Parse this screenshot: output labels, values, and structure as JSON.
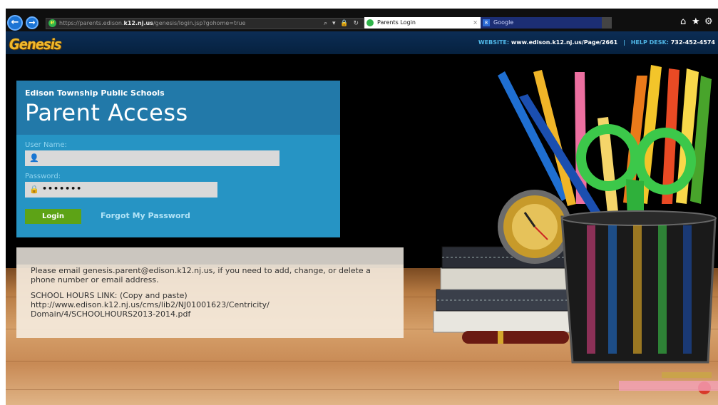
{
  "browser": {
    "url_prefix": "https://parents.edison.",
    "url_domain": "k12.nj.us",
    "url_path": "/genesis/login.jsp?gohome=true",
    "address_tools": "⌕ ▾ 🔒 ↻",
    "tabs": [
      {
        "label": "Parents Login",
        "close": "×"
      },
      {
        "label": "Google"
      }
    ],
    "icons": [
      "back-icon",
      "forward-icon",
      "home-icon",
      "favorites-star-icon",
      "settings-gear-icon"
    ]
  },
  "header": {
    "logo": "Genesis",
    "website_label": "WEBSITE:",
    "website_value": "www.edison.k12.nj.us/Page/2661",
    "separator": "|",
    "helpdesk_label": "HELP DESK:",
    "helpdesk_value": "732-452-4574"
  },
  "login": {
    "district": "Edison Township Public Schools",
    "title": "Parent Access",
    "username_label": "User Name:",
    "username_value": "",
    "password_label": "Password:",
    "password_value": "•••••••",
    "login_button": "Login",
    "forgot_link": "Forgot My Password"
  },
  "info": {
    "line1": "Please email genesis.parent@edison.k12.nj.us, if you need to add, change, or delete a",
    "line2": "phone number or email address.",
    "hours_title": "SCHOOL HOURS LINK: (Copy and paste)",
    "hours_line1": "http://www.edison.k12.nj.us/cms/lib2/NJ01001623/Centricity/",
    "hours_line2": "Domain/4/SCHOOLHOURS2013-2014.pdf"
  },
  "colors": {
    "login_panel": "#2694c4",
    "login_header": "#2279a9",
    "login_button": "#5da316",
    "site_header": "#0c2d55",
    "logo": "#f0b92d"
  }
}
